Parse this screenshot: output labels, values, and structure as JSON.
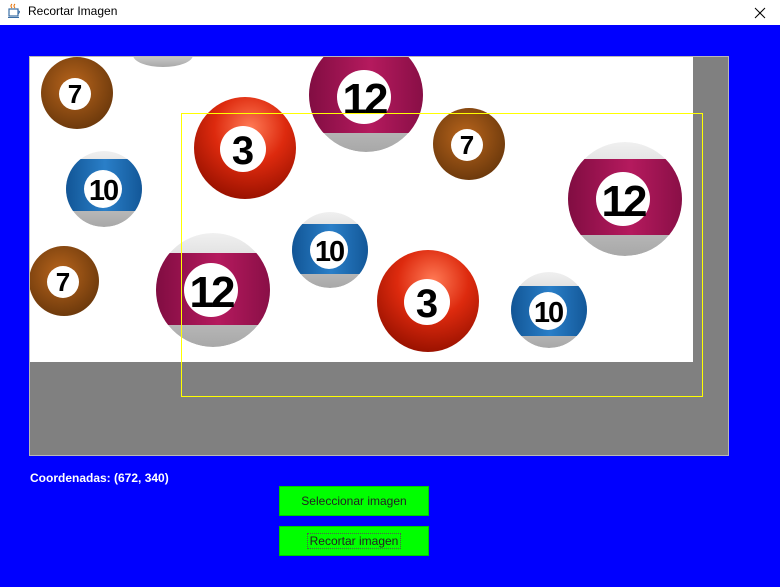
{
  "window": {
    "title": "Recortar Imagen",
    "icon": "java-icon",
    "close_icon": "close-icon"
  },
  "image": {
    "balls": [
      {
        "kind": "ball-7",
        "number": "7"
      },
      {
        "kind": "ball-10",
        "number": "10"
      },
      {
        "kind": "ball-7",
        "number": "7"
      },
      {
        "kind": "ball-3",
        "number": "3"
      },
      {
        "kind": "ball-12",
        "number": "12"
      },
      {
        "kind": "ball-12",
        "number": "12"
      },
      {
        "kind": "ball-10",
        "number": "10"
      },
      {
        "kind": "ball-7",
        "number": "7"
      },
      {
        "kind": "ball-3",
        "number": "3"
      },
      {
        "kind": "ball-12",
        "number": "12"
      },
      {
        "kind": "ball-10",
        "number": "10"
      }
    ]
  },
  "status": {
    "coordinates_label": "Coordenadas: (672, 340)"
  },
  "buttons": {
    "select_label": "Seleccionar imagen",
    "crop_label": "Recortar imagen"
  },
  "colors": {
    "background": "#0000ff",
    "button": "#00ff00",
    "selection": "#ffff00",
    "panel": "#808080"
  }
}
